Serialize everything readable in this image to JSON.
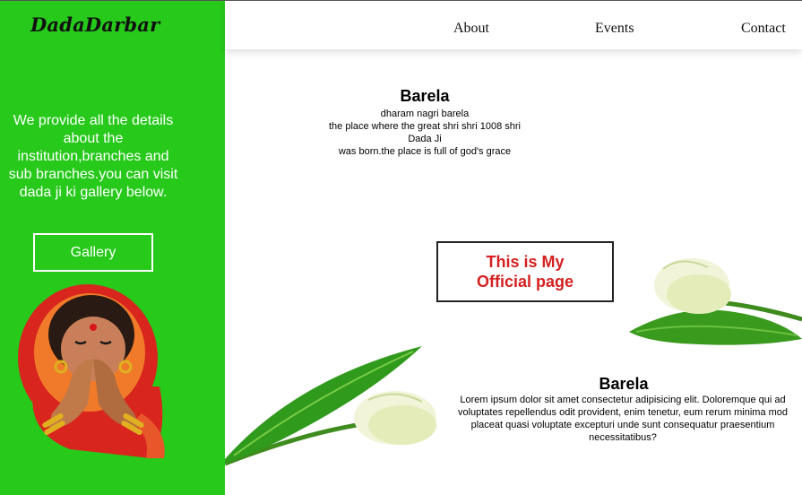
{
  "sidebar": {
    "brand": "DadaDarbar",
    "intro_text": "We provide all the details about the institution,branches and sub branches.you can visit dada ji ki gallery below.",
    "gallery_button": "Gallery"
  },
  "nav": {
    "items": [
      "About",
      "Events",
      "Contact"
    ]
  },
  "section1": {
    "title": "Barela",
    "lines": [
      "dharam nagri barela",
      "the place where the great shri shri 1008 shri",
      "Dada Ji",
      "was born.the place is full of god's grace"
    ]
  },
  "official": {
    "line1": "This is My",
    "line2": "Official page"
  },
  "section2": {
    "title": "Barela",
    "lines": [
      "Lorem ipsum dolor sit amet consectetur adipisicing elit. Doloremque qui ad",
      "voluptates repellendus odit provident, enim tenetur, eum rerum minima mod",
      "placeat quasi voluptate excepturi unde sunt consequatur praesentium",
      "necessitatibus?"
    ]
  },
  "colors": {
    "sidebar": "#27c91b",
    "accent_text": "#d42020"
  },
  "icons": [
    "namaste-woman-illustration",
    "tulip-flower-image"
  ]
}
